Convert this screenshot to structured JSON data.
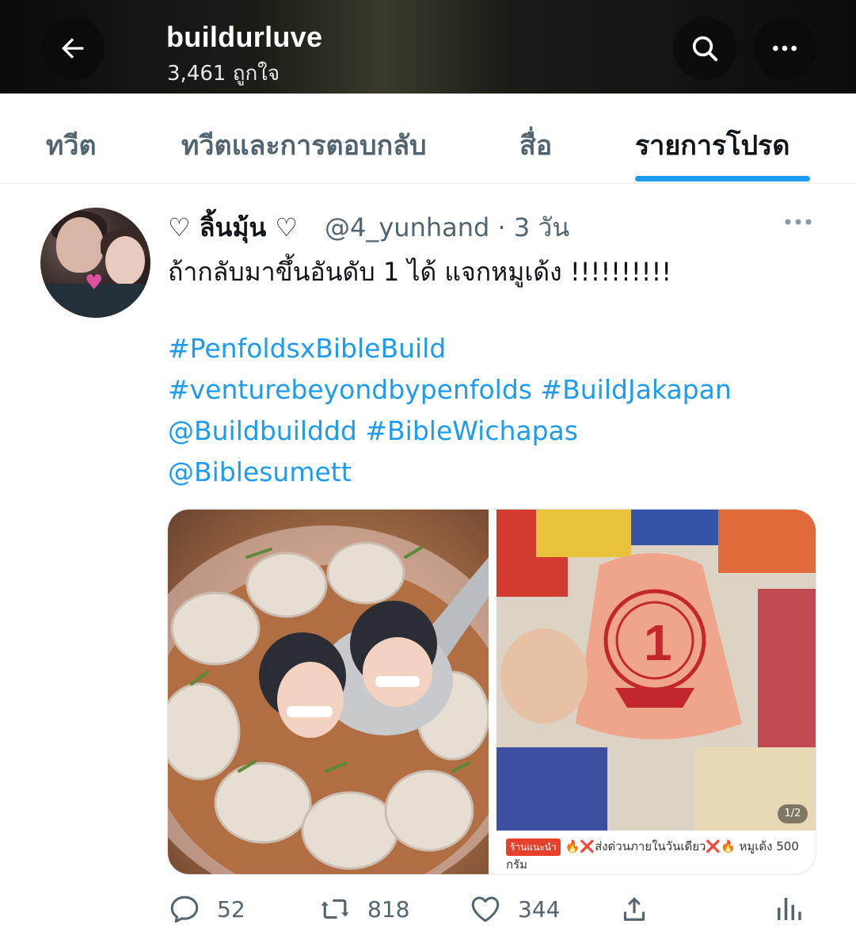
{
  "header": {
    "display_name": "buildurluve",
    "likes_count": "3,461 ถูกใจ",
    "back_icon": "arrow-left-icon",
    "search_icon": "search-icon",
    "more_icon": "more-horizontal-icon"
  },
  "tabs": [
    {
      "label": "ทวีต",
      "active": false
    },
    {
      "label": "ทวีตและการตอบกลับ",
      "active": false
    },
    {
      "label": "สื่อ",
      "active": false
    },
    {
      "label": "รายการโปรด",
      "active": true
    }
  ],
  "tweet": {
    "author_name": "♡ ลิ้นมุ้น ♡",
    "meta": "@4_yunhand · 3 วัน",
    "text": "ถ้ากลับมาขึ้นอันดับ 1 ได้ แจกหมูเด้ง !!!!!!!!!!",
    "links": [
      "#PenfoldsxBibleBuild",
      "#venturebeyondbypenfolds #BuildJakapan",
      "@Buildbuilddd #BibleWichapas",
      "@Biblesumett"
    ],
    "media": {
      "counter": "1/2",
      "caption_tag": "ร้านแนะนำ",
      "caption": "🔥❌ส่งด่วนภายในวันเดียว❌🔥  หมูเด้ง 500 กรัม"
    },
    "actions": {
      "replies": "52",
      "retweets": "818",
      "likes": "344"
    }
  },
  "colors": {
    "accent": "#1d9bf0",
    "text_primary": "#0f1419",
    "text_secondary": "#536471"
  }
}
